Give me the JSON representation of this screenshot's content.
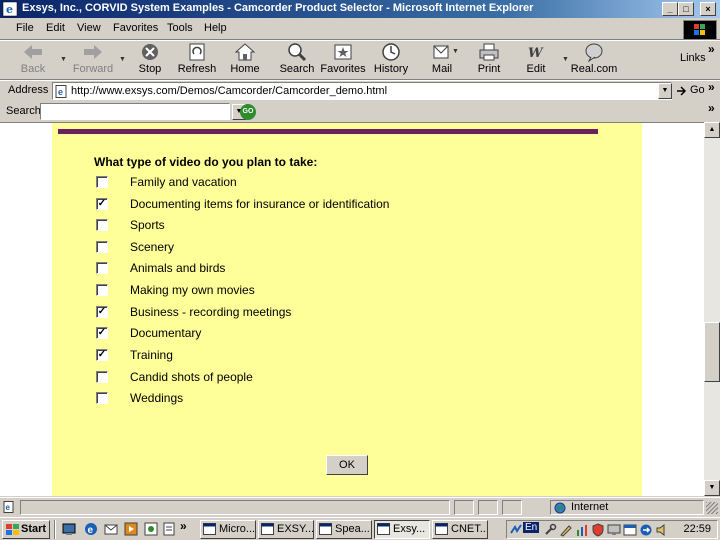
{
  "window": {
    "title": "Exsys, Inc., CORVID System Examples - Camcorder Product Selector - Microsoft Internet Explorer",
    "controls": [
      "_",
      "□",
      "×"
    ]
  },
  "menu": [
    {
      "label": "File"
    },
    {
      "label": "Edit"
    },
    {
      "label": "View"
    },
    {
      "label": "Favorites"
    },
    {
      "label": "Tools"
    },
    {
      "label": "Help"
    }
  ],
  "toolbar": {
    "back": "Back",
    "forward": "Forward",
    "stop": "Stop",
    "refresh": "Refresh",
    "home": "Home",
    "search": "Search",
    "favorites": "Favorites",
    "history": "History",
    "mail": "Mail",
    "print": "Print",
    "edit": "Edit",
    "realcom": "Real.com",
    "links": "Links",
    "chevron": "»"
  },
  "address": {
    "label": "Address",
    "url": "http://www.exsys.com/Demos/Camcorder/Camcorder_demo.html",
    "go": "Go",
    "chevron": "»"
  },
  "search": {
    "label": "Search",
    "value": "",
    "go": "GO",
    "chevron": "»"
  },
  "form": {
    "question": "What type of video do you plan to take:",
    "options": [
      {
        "label": "Family and vacation",
        "checked": false,
        "mark": ""
      },
      {
        "label": "Documenting items for insurance or identification",
        "checked": true,
        "mark": "✓"
      },
      {
        "label": "Sports",
        "checked": false,
        "mark": ""
      },
      {
        "label": "Scenery",
        "checked": false,
        "mark": ""
      },
      {
        "label": "Animals and birds",
        "checked": false,
        "mark": ""
      },
      {
        "label": "Making my own movies",
        "checked": false,
        "mark": ""
      },
      {
        "label": "Business - recording meetings",
        "checked": true,
        "mark": "✓"
      },
      {
        "label": "Documentary",
        "checked": true,
        "mark": "✓"
      },
      {
        "label": "Training",
        "checked": true,
        "mark": "✓"
      },
      {
        "label": "Candid shots of people",
        "checked": false,
        "mark": ""
      },
      {
        "label": "Weddings",
        "checked": false,
        "mark": ""
      }
    ],
    "ok": "OK"
  },
  "status": {
    "zone": "Internet"
  },
  "taskbar": {
    "start": "Start",
    "chevron": "»",
    "tasks": [
      {
        "label": "Micro...",
        "active": false
      },
      {
        "label": "EXSY...",
        "active": false
      },
      {
        "label": "Spea...",
        "active": false
      },
      {
        "label": "Exsy...",
        "active": true
      },
      {
        "label": "CNET...",
        "active": false
      }
    ],
    "tray_lang": "En",
    "clock": "22:59"
  },
  "colors": {
    "page_background": "#ffff99",
    "header_bar": "#6b2060",
    "titlebar": "#0a246a"
  }
}
